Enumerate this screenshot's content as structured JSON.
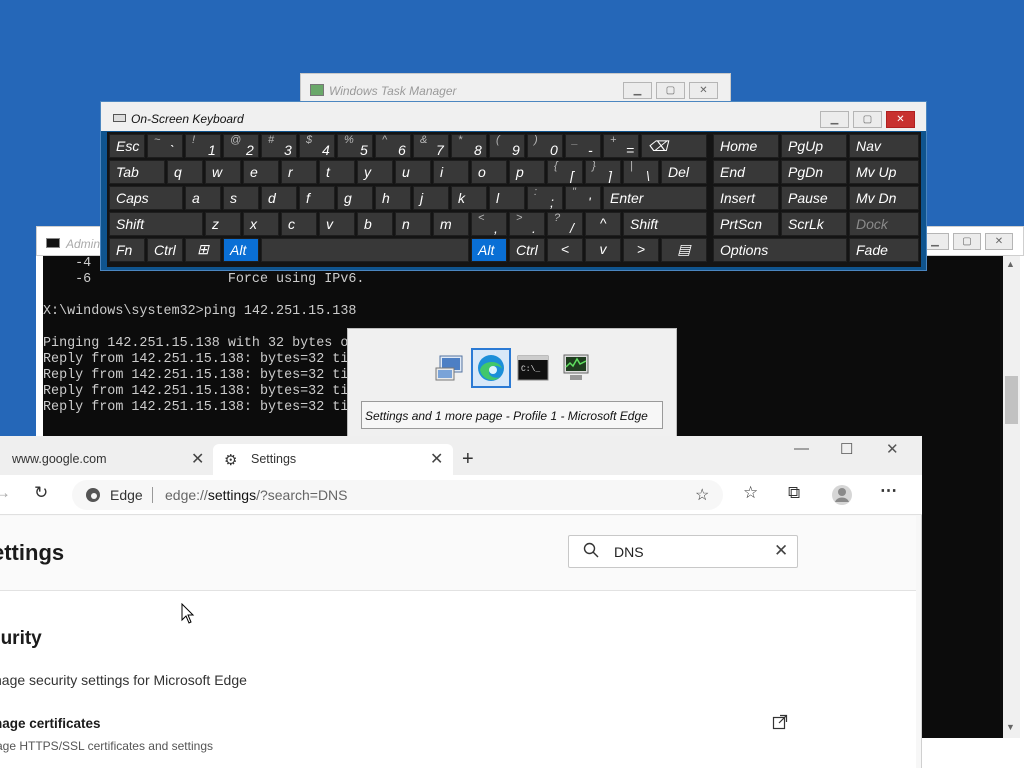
{
  "task_manager": {
    "title": "Windows Task Manager"
  },
  "cmd": {
    "title": "Admin",
    "lines": [
      "    -4",
      "    -6                 Force using IPv6.",
      "",
      "X:\\windows\\system32>ping 142.251.15.138",
      "",
      "Pinging 142.251.15.138 with 32 bytes o",
      "Reply from 142.251.15.138: bytes=32 ti",
      "Reply from 142.251.15.138: bytes=32 ti",
      "Reply from 142.251.15.138: bytes=32 ti",
      "Reply from 142.251.15.138: bytes=32 ti"
    ]
  },
  "osk": {
    "title": "On-Screen Keyboard",
    "rows": {
      "r1": [
        "Esc",
        "~",
        "`",
        "!",
        "1",
        "@",
        "2",
        "#",
        "3",
        "$",
        "4",
        "%",
        "5",
        "^",
        "6",
        "&",
        "7",
        "*",
        "8",
        "(",
        "9",
        ")",
        "0",
        "_",
        "-",
        "+",
        "=",
        "⌫"
      ],
      "r2": [
        "Tab",
        "q",
        "w",
        "e",
        "r",
        "t",
        "y",
        "u",
        "i",
        "o",
        "p",
        "{",
        "[",
        "}",
        "]",
        "|",
        "\\",
        "Del"
      ],
      "r3": [
        "Caps",
        "a",
        "s",
        "d",
        "f",
        "g",
        "h",
        "j",
        "k",
        "l",
        ":",
        ";",
        "\"",
        "'",
        "Enter"
      ],
      "r4": [
        "Shift",
        "z",
        "x",
        "c",
        "v",
        "b",
        "n",
        "m",
        "<",
        ",",
        ">",
        ".",
        "?",
        "/",
        "^",
        "Shift"
      ],
      "r5": [
        "Fn",
        "Ctrl",
        "⊞",
        "Alt",
        "Alt",
        "Ctrl",
        "<",
        "v",
        ">",
        "▤"
      ]
    },
    "nav": {
      "r1": [
        "Home",
        "PgUp",
        "Nav"
      ],
      "r2": [
        "End",
        "PgDn",
        "Mv Up"
      ],
      "r3": [
        "Insert",
        "Pause",
        "Mv Dn"
      ],
      "r4": [
        "PrtScn",
        "ScrLk",
        "Dock"
      ],
      "r5": [
        "Options",
        "Fade"
      ]
    }
  },
  "switcher": {
    "caption": "Settings and 1 more page - Profile 1 - Microsoft Edge",
    "icons": [
      "remote-desktop-icon",
      "edge-icon",
      "cmd-icon",
      "task-manager-icon"
    ]
  },
  "edge": {
    "tabs": [
      {
        "label": "www.google.com"
      },
      {
        "label": "Settings"
      }
    ],
    "address": {
      "brand": "Edge",
      "url_prefix": "edge://",
      "url_bold": "settings",
      "url_suffix": "/?search=DNS"
    },
    "settings": {
      "title": "ettings",
      "search_value": "DNS",
      "section_title": "curity",
      "section_desc": "nage security settings for Microsoft Edge",
      "cert_title": "nage certificates",
      "cert_desc": "age HTTPS/SSL certificates and settings"
    }
  },
  "colors": {
    "desktop": "#2567b8",
    "osk_active_key": "#0a6fd5",
    "osk_close": "#c8312f"
  }
}
